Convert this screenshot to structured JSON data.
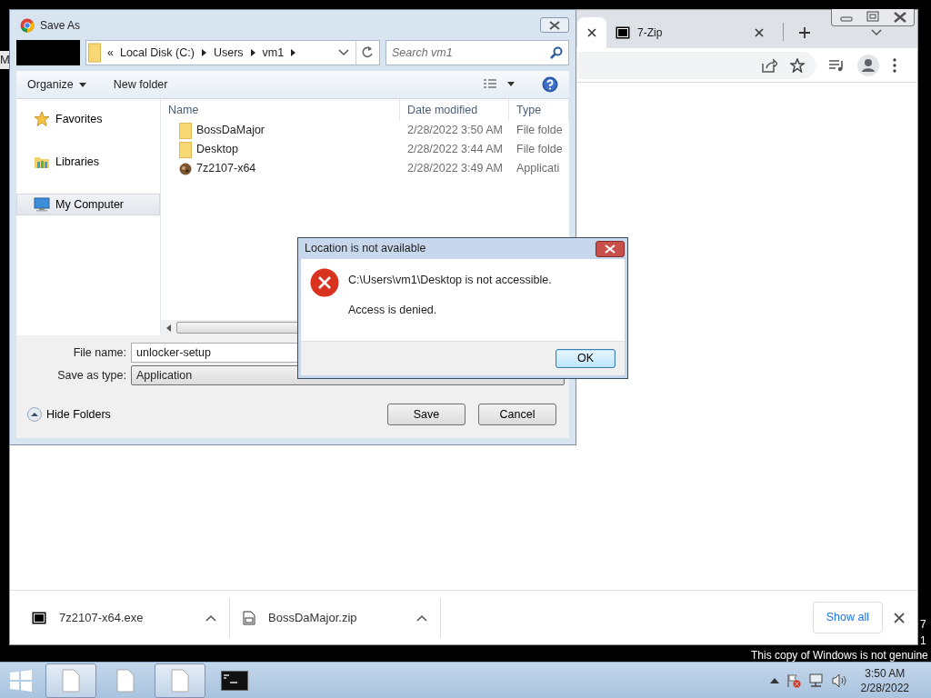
{
  "desktop": {
    "left_edge_text": "M",
    "right_edge_texts": [
      "7",
      "1"
    ],
    "genuine_notice": "This copy of Windows is not genuine"
  },
  "browser": {
    "tabs": [
      {
        "selected": true
      },
      {
        "label": "7-Zip",
        "selected": false
      }
    ],
    "downloads": [
      {
        "name": "7z2107-x64.exe",
        "kind": "exe"
      },
      {
        "name": "BossDaMajor.zip",
        "kind": "zip"
      }
    ],
    "show_all": "Show all"
  },
  "save_dialog": {
    "title": "Save As",
    "breadcrumb_prefix": "«",
    "breadcrumb": [
      "Local Disk (C:)",
      "Users",
      "vm1"
    ],
    "search_placeholder": "Search vm1",
    "toolbar": {
      "organize": "Organize",
      "new_folder": "New folder"
    },
    "sidebar": [
      {
        "label": "Favorites",
        "kind": "favorites",
        "selected": false
      },
      {
        "label": "Libraries",
        "kind": "libraries",
        "selected": false
      },
      {
        "label": "My Computer",
        "kind": "computer",
        "selected": true
      }
    ],
    "columns": [
      "Name",
      "Date modified",
      "Type"
    ],
    "files": [
      {
        "name": "BossDaMajor",
        "date": "2/28/2022 3:50 AM",
        "type": "File folde",
        "kind": "folder"
      },
      {
        "name": "Desktop",
        "date": "2/28/2022 3:44 AM",
        "type": "File folde",
        "kind": "folder"
      },
      {
        "name": "7z2107-x64",
        "date": "2/28/2022 3:49 AM",
        "type": "Applicati",
        "kind": "app"
      }
    ],
    "file_name_label": "File name:",
    "file_name": "unlocker-setup",
    "type_label": "Save as type:",
    "save_type": "Application",
    "hide_folders": "Hide Folders",
    "buttons": [
      "Save",
      "Cancel"
    ]
  },
  "error_dialog": {
    "title": "Location is not available",
    "lines": [
      "C:\\Users\\vm1\\Desktop is not accessible.",
      "Access is denied."
    ],
    "ok": "OK"
  },
  "taskbar": {
    "buttons": [
      {
        "kind": "document",
        "active": true
      },
      {
        "kind": "document",
        "active": false
      },
      {
        "kind": "document",
        "active": true
      },
      {
        "kind": "console",
        "active": false
      }
    ],
    "time": "3:50 AM",
    "date": "2/28/2022"
  }
}
